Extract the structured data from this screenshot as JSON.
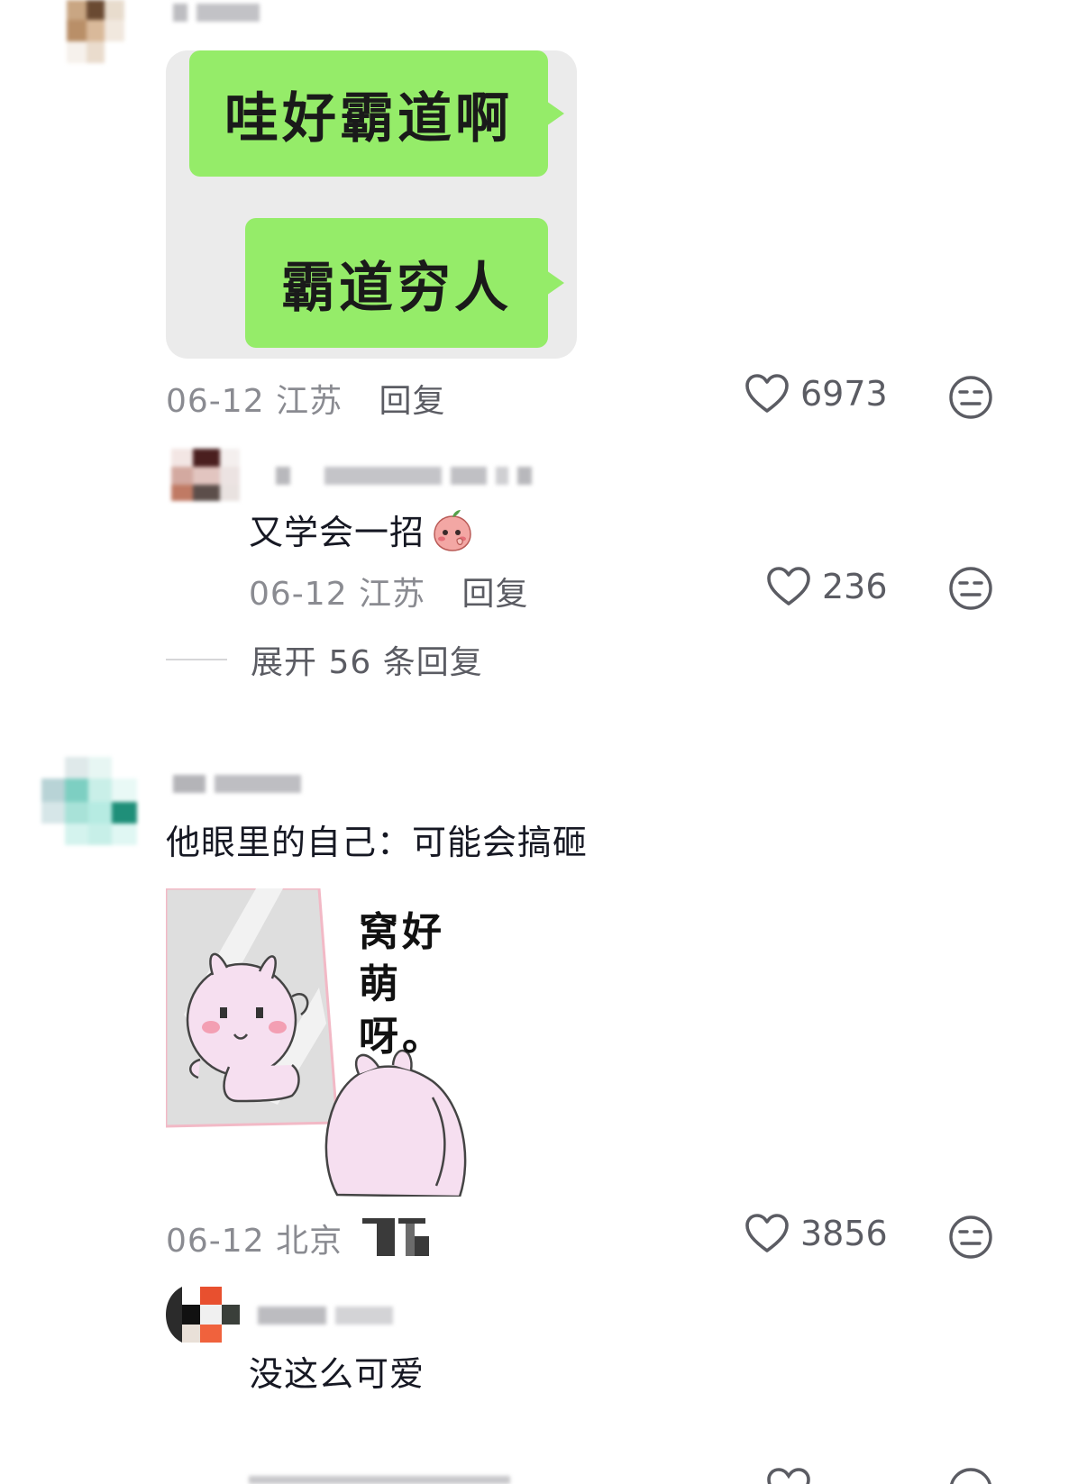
{
  "comments": [
    {
      "image_bubbles": [
        "哇好霸道啊",
        "霸道穷人"
      ],
      "date": "06-12",
      "location": "江苏",
      "reply_label": "回复",
      "likes": "6973",
      "replies": [
        {
          "text": "又学会一招",
          "date": "06-12",
          "location": "江苏",
          "reply_label": "回复",
          "likes": "236"
        }
      ],
      "expand_label": "展开 56 条回复"
    },
    {
      "text": "他眼里的自己：可能会搞砸",
      "meme_caption_line1": "窝好",
      "meme_caption_line2": "萌呀。",
      "date": "06-12",
      "location": "北京",
      "likes": "3856",
      "replies": [
        {
          "text": "没这么可爱"
        }
      ]
    }
  ],
  "icons": {
    "like": "heart-outline-icon",
    "dislike": "meh-face-icon"
  },
  "colors": {
    "bubble_green": "#95ec69",
    "meta_gray": "#8a8b91",
    "text_dark": "#161823"
  }
}
